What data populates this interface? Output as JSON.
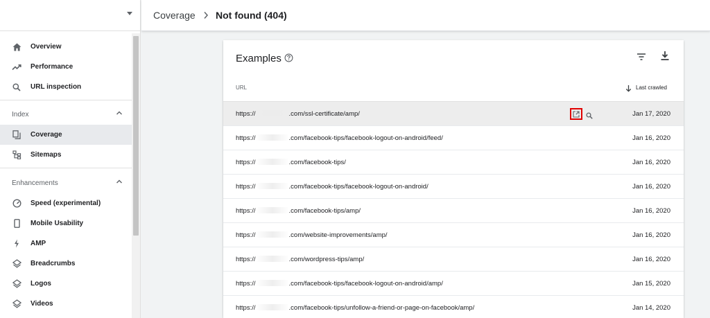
{
  "sidebar": {
    "nav_top": [
      {
        "label": "Overview",
        "icon": "home-icon"
      },
      {
        "label": "Performance",
        "icon": "trending-up-icon"
      },
      {
        "label": "URL inspection",
        "icon": "search-icon"
      }
    ],
    "sections": [
      {
        "label": "Index",
        "items": [
          {
            "label": "Coverage",
            "icon": "copy-icon",
            "active": true
          },
          {
            "label": "Sitemaps",
            "icon": "sitemap-icon"
          }
        ]
      },
      {
        "label": "Enhancements",
        "items": [
          {
            "label": "Speed (experimental)",
            "icon": "gauge-icon"
          },
          {
            "label": "Mobile Usability",
            "icon": "phone-icon"
          },
          {
            "label": "AMP",
            "icon": "bolt-icon"
          },
          {
            "label": "Breadcrumbs",
            "icon": "layers-icon"
          },
          {
            "label": "Logos",
            "icon": "layers-icon"
          },
          {
            "label": "Videos",
            "icon": "layers-icon"
          }
        ]
      }
    ]
  },
  "header": {
    "breadcrumb_parent": "Coverage",
    "separator": "›",
    "breadcrumb_current": "Not found (404)"
  },
  "examples": {
    "title": "Examples",
    "col_url": "URL",
    "col_date": "Last crawled",
    "rows": [
      {
        "prefix": "https://",
        "path": ".com/ssl-certificate/amp/",
        "date": "Jan 17, 2020"
      },
      {
        "prefix": "https://",
        "path": ".com/facebook-tips/facebook-logout-on-android/feed/",
        "date": "Jan 16, 2020"
      },
      {
        "prefix": "https://",
        "path": ".com/facebook-tips/",
        "date": "Jan 16, 2020"
      },
      {
        "prefix": "https://",
        "path": ".com/facebook-tips/facebook-logout-on-android/",
        "date": "Jan 16, 2020"
      },
      {
        "prefix": "https://",
        "path": ".com/facebook-tips/amp/",
        "date": "Jan 16, 2020"
      },
      {
        "prefix": "https://",
        "path": ".com/website-improvements/amp/",
        "date": "Jan 16, 2020"
      },
      {
        "prefix": "https://",
        "path": ".com/wordpress-tips/amp/",
        "date": "Jan 16, 2020"
      },
      {
        "prefix": "https://",
        "path": ".com/facebook-tips/facebook-logout-on-android/amp/",
        "date": "Jan 15, 2020"
      },
      {
        "prefix": "https://",
        "path": ".com/facebook-tips/unfollow-a-friend-or-page-on-facebook/amp/",
        "date": "Jan 14, 2020"
      }
    ]
  },
  "colors": {
    "highlight_border": "#e00000",
    "active_nav_bg": "#e8eaed",
    "text": "#202124"
  }
}
